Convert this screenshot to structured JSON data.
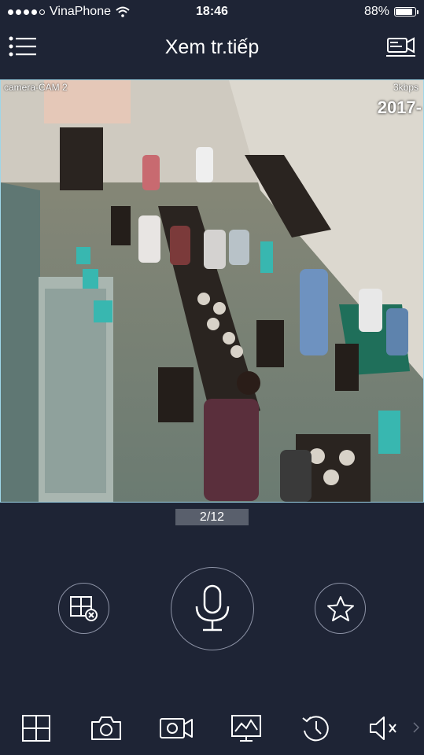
{
  "status_bar": {
    "carrier": "VinaPhone",
    "time": "18:46",
    "battery_percent": "88%",
    "battery_level": 0.88,
    "signal_bars": 4,
    "signal_total": 5
  },
  "header": {
    "title": "Xem tr.tiếp",
    "menu_icon": "hamburger-menu-icon",
    "record_icon": "video-record-icon"
  },
  "video": {
    "camera_label": "camera-CAM 2",
    "bitrate": "3kbps",
    "timestamp": "2017-"
  },
  "pager": {
    "label": "2/12"
  },
  "controls": {
    "close_view_icon": "close-view-icon",
    "mic_icon": "microphone-icon",
    "star_icon": "star-icon"
  },
  "toolbar": {
    "items": [
      "grid-layout-icon",
      "camera-snapshot-icon",
      "video-record-icon",
      "monitor-activity-icon",
      "playback-history-icon",
      "mute-icon"
    ]
  },
  "colors": {
    "background": "#1e2435",
    "accent_border": "#9fd6e8",
    "button_outline": "#8d93a6"
  }
}
